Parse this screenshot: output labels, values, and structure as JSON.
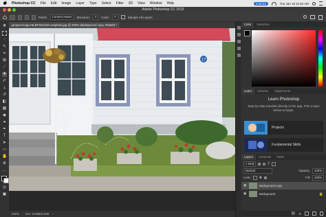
{
  "menubar": {
    "apple": "",
    "app_name": "Photoshop CC",
    "items": [
      "File",
      "Edit",
      "Image",
      "Layer",
      "Type",
      "Select",
      "Filter",
      "3D",
      "View",
      "Window",
      "Help"
    ],
    "clock": "1:02:21",
    "datetime": "Tue Jan 18  11:52 AM"
  },
  "window": {
    "title": "Adobe Photoshop CC 2019"
  },
  "options_bar": {
    "patch_label": "Patch:",
    "patch_value": "Content-Aware",
    "structure_label": "Structure:",
    "structure_value": "4",
    "color_label": "Color:",
    "color_value": "0",
    "sample_all_layers": "Sample All Layers"
  },
  "document": {
    "tab_title": "jacques-kopp-HtLBFO5cGsk-unsplash.jpg @ 200% (Background copy, RGB/8) *",
    "house_number": "17",
    "zoom": "200%",
    "doc_size": "Doc: 8.29M/8.29M"
  },
  "panels": {
    "color_tabs": [
      "Color",
      "Swatches"
    ],
    "learn_tabs": [
      "Learn",
      "Libraries",
      "Adjustments"
    ],
    "learn_title": "Learn Photoshop",
    "learn_desc": "Step-by-step tutorials directly in the app. Pick a topic below to begin.",
    "learn_items": [
      "Projects",
      "Fundamental Skills"
    ],
    "layers_tabs": [
      "Layers",
      "Channels",
      "Paths"
    ],
    "kind_label": "Kind",
    "blend_mode": "Normal",
    "opacity_label": "Opacity:",
    "opacity_value": "100%",
    "lock_label": "Lock:",
    "fill_label": "Fill:",
    "fill_value": "100%",
    "layers": [
      {
        "name": "Background copy",
        "selected": true
      },
      {
        "name": "Background",
        "selected": false
      }
    ]
  },
  "colors": {
    "accent": "#2a6ad8",
    "roof": "#d34a5a",
    "house_wall": "#e9ecef",
    "window_frame": "#8b96b8"
  }
}
